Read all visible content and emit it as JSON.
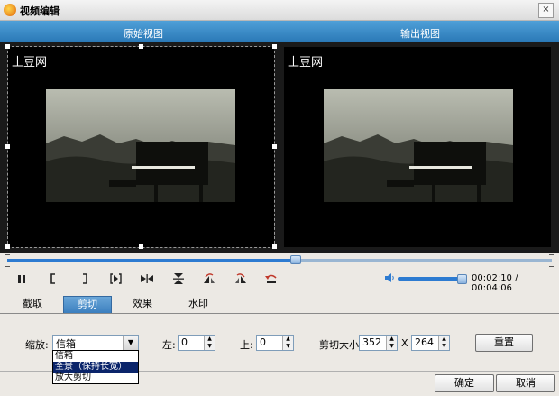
{
  "window": {
    "title": "视频编辑",
    "close_glyph": "×"
  },
  "views": {
    "original": "原始视图",
    "output": "输出视图"
  },
  "watermark": "土豆网",
  "playback": {
    "progress": 0.53,
    "volume": 0.95,
    "current_time": "00:02:10",
    "total_time": "00:04:06",
    "time_separator": "/",
    "buttons": [
      "pause-icon",
      "mark-in-icon",
      "mark-out-icon",
      "next-frame-icon",
      "flip-icon",
      "flip-vertical-icon",
      "rotate-left-icon",
      "rotate-right-icon",
      "undo-icon"
    ]
  },
  "tabs": [
    {
      "label": "截取"
    },
    {
      "label": "剪切"
    },
    {
      "label": "效果"
    },
    {
      "label": "水印"
    }
  ],
  "active_tab": 1,
  "crop": {
    "zoom_label": "缩放:",
    "zoom_value": "信箱",
    "zoom_options": [
      "信箱",
      "全景（保持长宽）",
      "放大剪切"
    ],
    "zoom_highlight": 1,
    "left_label": "左:",
    "left_value": "0",
    "top_label": "上:",
    "top_value": "0",
    "size_label": "剪切大小:",
    "width_value": "352",
    "times": "X",
    "height_value": "264",
    "reset_label": "重置"
  },
  "footer": {
    "ok_label": "确定",
    "cancel_label": "取消"
  },
  "colors": {
    "header_blue": "#3a87c6",
    "accent": "#2d7bd1",
    "selection": "#0a246a"
  }
}
